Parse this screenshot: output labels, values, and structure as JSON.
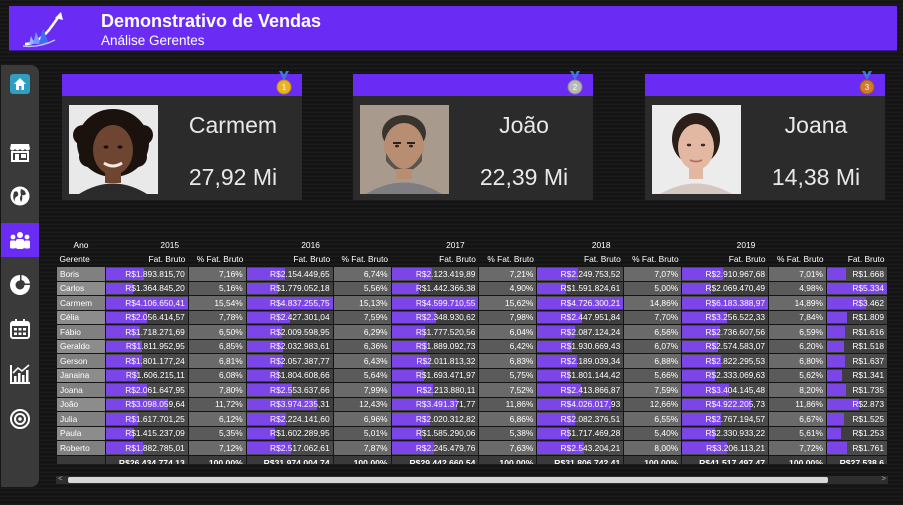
{
  "header": {
    "title": "Demonstrativo de Vendas",
    "subtitle": "Análise Gerentes"
  },
  "sidenav": [
    {
      "icon": "home-icon"
    },
    {
      "icon": "store-icon"
    },
    {
      "icon": "globe-icon"
    },
    {
      "icon": "team-icon",
      "active": true
    },
    {
      "icon": "donut-chart-icon"
    },
    {
      "icon": "calendar-icon"
    },
    {
      "icon": "line-chart-icon"
    },
    {
      "icon": "target-icon"
    }
  ],
  "cards": [
    {
      "name": "Carmem",
      "value": "27,92 Mi",
      "medal": "1",
      "medal_color": "#e6b422"
    },
    {
      "name": "João",
      "value": "22,39 Mi",
      "medal": "2",
      "medal_color": "#b8b8b8"
    },
    {
      "name": "Joana",
      "value": "14,38 Mi",
      "medal": "3",
      "medal_color": "#d07a2a"
    }
  ],
  "matrix": {
    "row_header_label": "Ano",
    "row_sub_label": "Gerente",
    "years": [
      "2015",
      "2016",
      "2017",
      "2018",
      "2019",
      ""
    ],
    "measure_labels": {
      "fat": "Fat. Bruto",
      "pct": "% Fat. Bruto"
    },
    "rows": [
      {
        "name": "Boris",
        "cells": [
          [
            "R$1.893.815,70",
            "7,16%"
          ],
          [
            "R$2.154.449,65",
            "6,74%"
          ],
          [
            "R$2.123.419,89",
            "7,21%"
          ],
          [
            "R$2.249.753,52",
            "7,07%"
          ],
          [
            "R$2.910.967,68",
            "7,01%"
          ],
          [
            "R$1.668",
            ""
          ]
        ]
      },
      {
        "name": "Carlos",
        "cells": [
          [
            "R$1.364.845,20",
            "5,16%"
          ],
          [
            "R$1.779.052,18",
            "5,56%"
          ],
          [
            "R$1.442.366,38",
            "4,90%"
          ],
          [
            "R$1.591.824,61",
            "5,00%"
          ],
          [
            "R$2.069.470,49",
            "4,98%"
          ],
          [
            "R$5.334",
            ""
          ]
        ]
      },
      {
        "name": "Carmem",
        "cells": [
          [
            "R$4.106.650,41",
            "15,54%"
          ],
          [
            "R$4.837.255,75",
            "15,13%"
          ],
          [
            "R$4.599.710,55",
            "15,62%"
          ],
          [
            "R$4.726.300,21",
            "14,86%"
          ],
          [
            "R$6.183.388,97",
            "14,89%"
          ],
          [
            "R$3.462",
            ""
          ]
        ]
      },
      {
        "name": "Célia",
        "cells": [
          [
            "R$2.056.414,57",
            "7,78%"
          ],
          [
            "R$2.427.301,04",
            "7,59%"
          ],
          [
            "R$2.348.930,62",
            "7,98%"
          ],
          [
            "R$2.447.951,84",
            "7,70%"
          ],
          [
            "R$3.256.522,33",
            "7,84%"
          ],
          [
            "R$1.809",
            ""
          ]
        ]
      },
      {
        "name": "Fábio",
        "cells": [
          [
            "R$1.718.271,69",
            "6,50%"
          ],
          [
            "R$2.009.598,95",
            "6,29%"
          ],
          [
            "R$1.777.520,56",
            "6,04%"
          ],
          [
            "R$2.087.124,24",
            "6,56%"
          ],
          [
            "R$2.736.607,56",
            "6,59%"
          ],
          [
            "R$1.616",
            ""
          ]
        ]
      },
      {
        "name": "Geraldo",
        "cells": [
          [
            "R$1.811.952,95",
            "6,85%"
          ],
          [
            "R$2.032.983,61",
            "6,36%"
          ],
          [
            "R$1.889.092,73",
            "6,42%"
          ],
          [
            "R$1.930.669,43",
            "6,07%"
          ],
          [
            "R$2.574.583,07",
            "6,20%"
          ],
          [
            "R$1.518",
            ""
          ]
        ]
      },
      {
        "name": "Gerson",
        "cells": [
          [
            "R$1.801.177,24",
            "6,81%"
          ],
          [
            "R$2.057.387,77",
            "6,43%"
          ],
          [
            "R$2.011.813,32",
            "6,83%"
          ],
          [
            "R$2.189.039,34",
            "6,88%"
          ],
          [
            "R$2.822.295,53",
            "6,80%"
          ],
          [
            "R$1.637",
            ""
          ]
        ]
      },
      {
        "name": "Janaina",
        "cells": [
          [
            "R$1.606.215,11",
            "6,08%"
          ],
          [
            "R$1.804.608,66",
            "5,64%"
          ],
          [
            "R$1.693.471,97",
            "5,75%"
          ],
          [
            "R$1.801.144,42",
            "5,66%"
          ],
          [
            "R$2.333.069,63",
            "5,62%"
          ],
          [
            "R$1.341",
            ""
          ]
        ]
      },
      {
        "name": "Joana",
        "cells": [
          [
            "R$2.061.647,95",
            "7,80%"
          ],
          [
            "R$2.553.637,66",
            "7,99%"
          ],
          [
            "R$2.213.880,11",
            "7,52%"
          ],
          [
            "R$2.413.866,87",
            "7,59%"
          ],
          [
            "R$3.404.145,48",
            "8,20%"
          ],
          [
            "R$1.735",
            ""
          ]
        ]
      },
      {
        "name": "João",
        "cells": [
          [
            "R$3.098.059,64",
            "11,72%"
          ],
          [
            "R$3.974.235,31",
            "12,43%"
          ],
          [
            "R$3.491.371,77",
            "11,86%"
          ],
          [
            "R$4.026.017,93",
            "12,66%"
          ],
          [
            "R$4.922.205,73",
            "11,86%"
          ],
          [
            "R$2.873",
            ""
          ]
        ]
      },
      {
        "name": "Julia",
        "cells": [
          [
            "R$1.617.701,25",
            "6,12%"
          ],
          [
            "R$2.224.141,60",
            "6,96%"
          ],
          [
            "R$2.020.312,82",
            "6,86%"
          ],
          [
            "R$2.082.376,51",
            "6,55%"
          ],
          [
            "R$2.767.194,57",
            "6,67%"
          ],
          [
            "R$1.525",
            ""
          ]
        ]
      },
      {
        "name": "Paula",
        "cells": [
          [
            "R$1.415.237,09",
            "5,35%"
          ],
          [
            "R$1.602.289,95",
            "5,01%"
          ],
          [
            "R$1.585.290,06",
            "5,38%"
          ],
          [
            "R$1.717.469,28",
            "5,40%"
          ],
          [
            "R$2.330.933,22",
            "5,61%"
          ],
          [
            "R$1.253",
            ""
          ]
        ]
      },
      {
        "name": "Roberto",
        "cells": [
          [
            "R$1.882.785,01",
            "7,12%"
          ],
          [
            "R$2.517.062,61",
            "7,87%"
          ],
          [
            "R$2.245.479,76",
            "7,63%"
          ],
          [
            "R$2.543.204,21",
            "8,00%"
          ],
          [
            "R$3.206.113,21",
            "7,72%"
          ],
          [
            "R$1.761",
            ""
          ]
        ]
      }
    ],
    "totals": [
      [
        "R$26.434.774,13",
        "100,00%"
      ],
      [
        "R$31.974.004,74",
        "100,00%"
      ],
      [
        "R$29.442.660,54",
        "100,00%"
      ],
      [
        "R$31.806.742,41",
        "100,00%"
      ],
      [
        "R$41.517.497,47",
        "100,00%"
      ],
      [
        "R$27.538.6",
        ""
      ]
    ],
    "bar_color": "#7b45e8"
  },
  "scrollbar": {
    "left_arrow": "<",
    "right_arrow": ">"
  }
}
